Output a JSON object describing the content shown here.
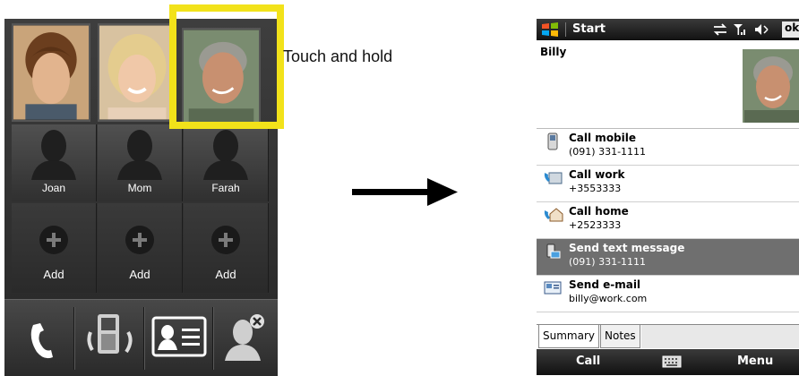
{
  "left_phone": {
    "photos": [
      {
        "icon": "young-man-photo"
      },
      {
        "icon": "woman-photo"
      },
      {
        "icon": "older-man-photo"
      }
    ],
    "contacts": [
      "Joan",
      "Mom",
      "Farah"
    ],
    "add_slots": [
      "Add",
      "Add",
      "Add"
    ],
    "bottom_bar": [
      "phone-icon",
      "device-icon",
      "contact-card-icon",
      "remove-contact-icon"
    ]
  },
  "annotation": {
    "instruction": "Touch and hold",
    "highlight_color": "#f2e21a"
  },
  "right_phone": {
    "title_bar": {
      "app_title": "Start",
      "ok_label": "ok",
      "status_icons": [
        "sync-icon",
        "signal-icon",
        "speaker-icon"
      ]
    },
    "contact": {
      "name": "Billy"
    },
    "actions": [
      {
        "icon": "mobile-phone-icon",
        "title": "Call mobile",
        "detail": "(091) 331-1111",
        "selected": false
      },
      {
        "icon": "work-phone-icon",
        "title": "Call work",
        "detail": "+3553333",
        "selected": false
      },
      {
        "icon": "home-phone-icon",
        "title": "Call home",
        "detail": "+2523333",
        "selected": false
      },
      {
        "icon": "sms-icon",
        "title": "Send text message",
        "detail": "(091) 331-1111",
        "selected": true
      },
      {
        "icon": "email-icon",
        "title": "Send e-mail",
        "detail": "billy@work.com",
        "selected": false
      }
    ],
    "tabs": [
      "Summary",
      "Notes"
    ],
    "softkeys": {
      "left": "Call",
      "right": "Menu",
      "center_icon": "keyboard-icon"
    },
    "selection_color": "#6f6f6f"
  }
}
